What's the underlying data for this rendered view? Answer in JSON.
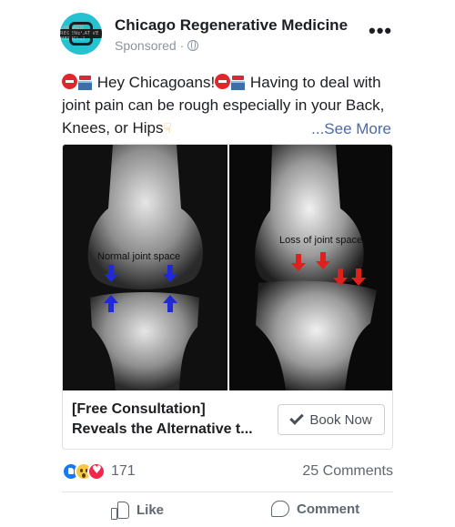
{
  "post": {
    "page_name": "Chicago Regenerative Medicine",
    "sponsored_label": "Sponsored ·",
    "more_label": "•••",
    "avatar_text": "CHICAGO REGENERATIVE MEDICINE",
    "text_line1": " Hey Chicagoans!",
    "text_line1b": " Having to deal with joint pain can be rough especially in your Back, Knees, or Hips",
    "see_more": "...See More",
    "icons": [
      "stop-sign-icon",
      "hospital-icon",
      "pointing-hand-icon",
      "globe-icon",
      "more-options-icon"
    ]
  },
  "ad": {
    "left_label": "Normal joint space",
    "right_label": "Loss of joint space",
    "headline_line1": "[Free Consultation]",
    "headline_line2": "Reveals the Alternative t...",
    "cta_label": "Book Now",
    "arrow_colors": {
      "normal": "#1f2ad6",
      "loss": "#e0201c"
    }
  },
  "engagement": {
    "reaction_count": "171",
    "reaction_types": [
      "like",
      "wow",
      "love"
    ],
    "comments": "25 Comments"
  },
  "actions": {
    "like_label": "Like",
    "comment_label": "Comment"
  }
}
